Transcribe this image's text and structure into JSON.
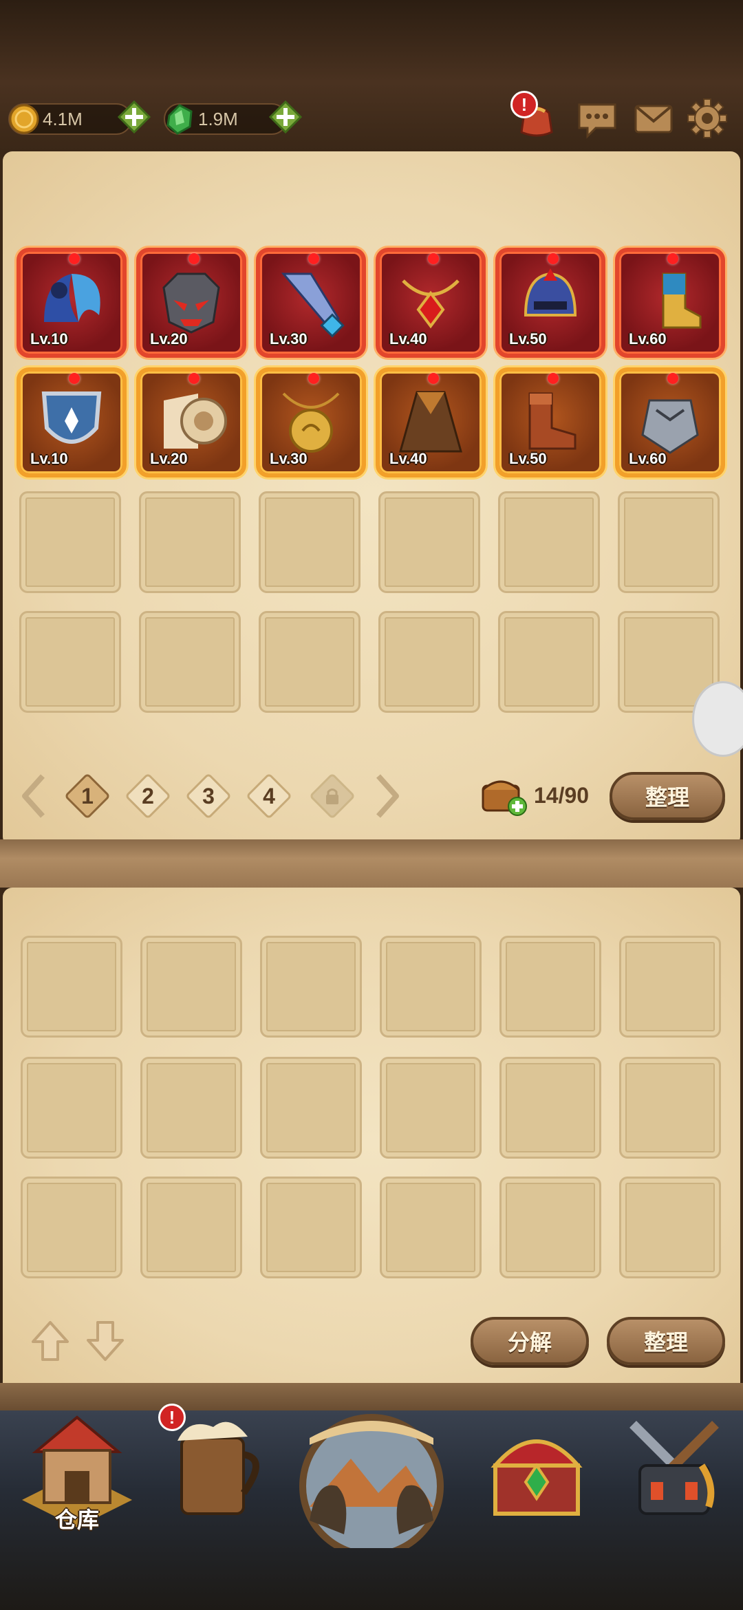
{
  "resources": {
    "coins": "4.1M",
    "gems": "1.9M"
  },
  "topbar": {
    "alert_badge": "!",
    "icons": [
      "bag-icon",
      "chat-icon",
      "mail-icon",
      "gear-icon"
    ]
  },
  "equipped_red": [
    {
      "level": "Lv.10",
      "icon": "wings-icon"
    },
    {
      "level": "Lv.20",
      "icon": "demon-mask-icon"
    },
    {
      "level": "Lv.30",
      "icon": "sword-icon"
    },
    {
      "level": "Lv.40",
      "icon": "amulet-icon"
    },
    {
      "level": "Lv.50",
      "icon": "helmet-icon"
    },
    {
      "level": "Lv.60",
      "icon": "boot-icon"
    }
  ],
  "equipped_orange": [
    {
      "level": "Lv.10",
      "icon": "shield-icon"
    },
    {
      "level": "Lv.20",
      "icon": "scroll-roll-icon"
    },
    {
      "level": "Lv.30",
      "icon": "pendant-icon"
    },
    {
      "level": "Lv.40",
      "icon": "cloak-icon"
    },
    {
      "level": "Lv.50",
      "icon": "boots-icon"
    },
    {
      "level": "Lv.60",
      "icon": "gauntlet-icon"
    }
  ],
  "pager": {
    "pages": [
      "1",
      "2",
      "3",
      "4"
    ],
    "active_page": "1",
    "capacity": "14/90",
    "sort_label": "整理"
  },
  "lower_panel": {
    "decompose_label": "分解",
    "sort_label": "整理"
  },
  "nav": {
    "warehouse_label": "仓库",
    "alert_badge": "!"
  },
  "colors": {
    "parchment": "#ecd8b0",
    "red_frame": "#e2462c",
    "orange_frame": "#f2a02a",
    "button_brown": "#8a6440"
  }
}
